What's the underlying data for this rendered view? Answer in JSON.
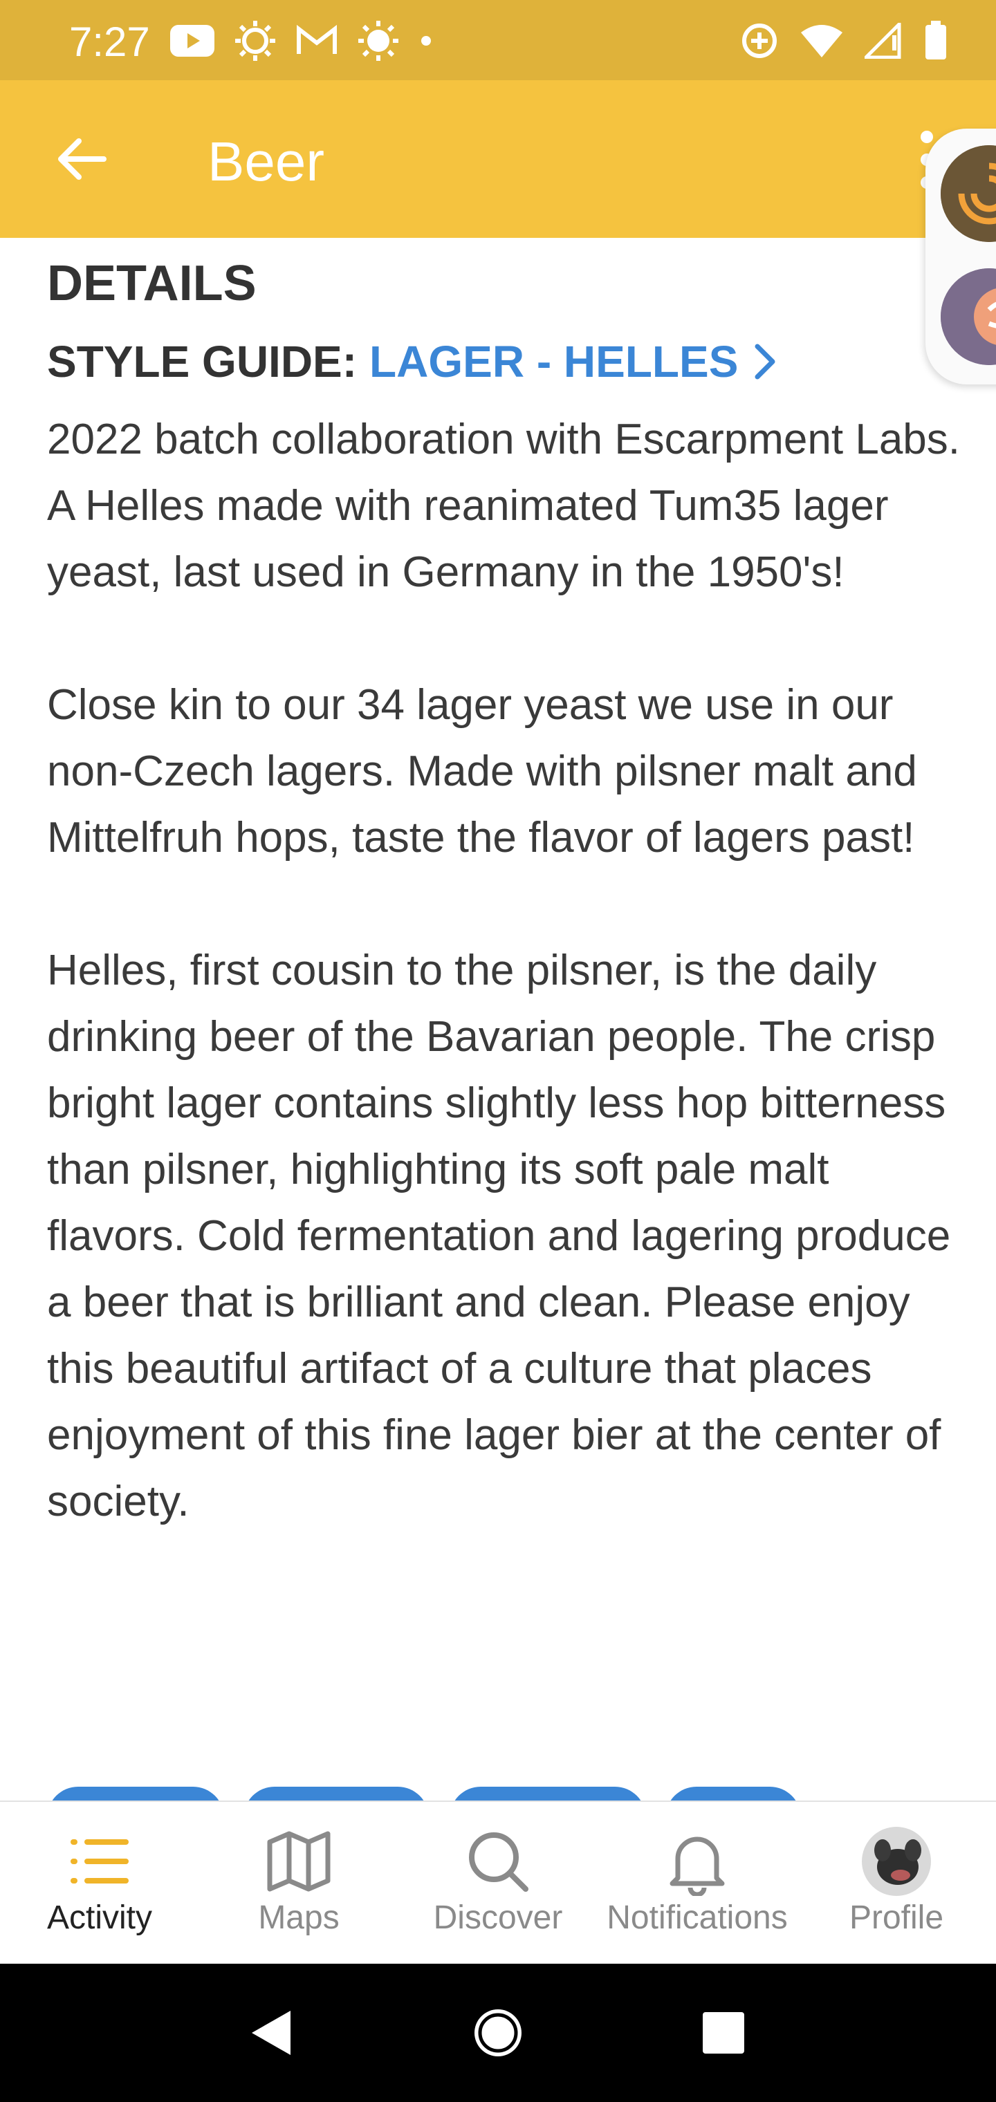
{
  "status_bar": {
    "time": "7:27",
    "left_icons": [
      "youtube-icon",
      "brightness-icon",
      "gmail-icon",
      "brightness-icon",
      "dot-icon"
    ],
    "right_icons": [
      "data-saver-icon",
      "wifi-icon",
      "signal-icon",
      "battery-icon"
    ]
  },
  "app_bar": {
    "title": "Beer",
    "back_icon": "arrow-left-icon",
    "menu_icon": "more-vert-icon"
  },
  "content": {
    "section_heading": "DETAILS",
    "style_guide_label": "STYLE GUIDE:",
    "style_guide_value": "LAGER - HELLES",
    "paragraphs": [
      "2022 batch collaboration with Escarpment Labs. A Helles made with reanimated Tum35 lager yeast, last used in Germany in the 1950's!",
      "Close kin to our 34 lager yeast we use in our non-Czech lagers. Made with pilsner malt and Mittelfruh hops, taste the flavor of lagers past!",
      "Helles, first cousin to the pilsner, is the daily drinking beer of the Bavarian people. The crisp bright lager contains slightly less hop bitterness than pilsner, highlighting its soft pale malt flavors. Cold fermentation and lagering produce a beer that is brilliant and clean. Please enjoy this beautiful artifact of a culture that places enjoyment of this fine lager bier at the center of society."
    ]
  },
  "bottom_nav": {
    "items": [
      {
        "label": "Activity",
        "icon": "list-icon",
        "active": true
      },
      {
        "label": "Maps",
        "icon": "map-icon",
        "active": false
      },
      {
        "label": "Discover",
        "icon": "search-icon",
        "active": false
      },
      {
        "label": "Notifications",
        "icon": "bell-icon",
        "active": false
      },
      {
        "label": "Profile",
        "icon": "avatar",
        "active": false
      }
    ]
  },
  "colors": {
    "status_bar": "#dfb23a",
    "app_bar": "#f5c33f",
    "link": "#3b86d6",
    "active_icon": "#f0b429"
  }
}
